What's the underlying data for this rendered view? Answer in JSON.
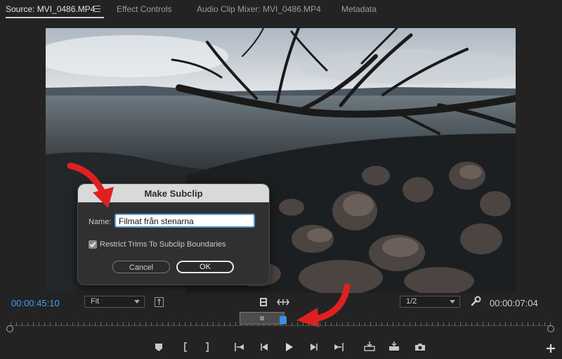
{
  "tabs": [
    {
      "label": "Source: MVI_0486.MP4"
    },
    {
      "label": "Effect Controls"
    },
    {
      "label": "Audio Clip Mixer: MVI_0486.MP4"
    },
    {
      "label": "Metadata"
    }
  ],
  "dialog": {
    "title": "Make Subclip",
    "name_label": "Name:",
    "name_value": "Filmat från stenarna",
    "restrict_label": "Restrict Trims To Subclip Boundaries",
    "restrict_checked": true,
    "cancel_label": "Cancel",
    "ok_label": "OK"
  },
  "controls": {
    "timecode_in": "00:00:45:10",
    "zoom_value": "Fit",
    "resolution_value": "1/2",
    "timecode_duration": "00:00:07:04"
  },
  "colors": {
    "accent": "#3aa0ff",
    "arrow": "#e02020",
    "panel_bg": "#232323"
  },
  "icons": {
    "add": "plus-icon",
    "settings": "wrench-icon"
  }
}
